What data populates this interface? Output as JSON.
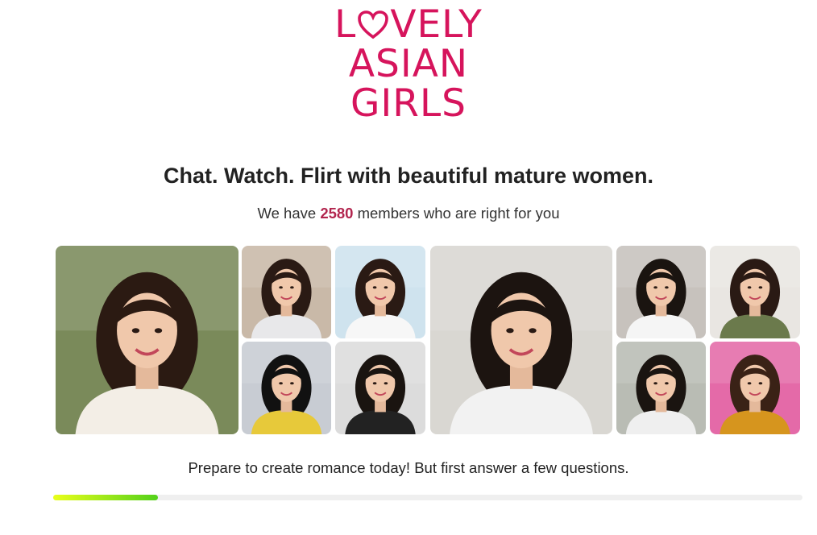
{
  "brand": {
    "logo_line1_before": "L",
    "logo_line1_after": "VELY",
    "logo_line2": "ASIAN",
    "logo_line3": "GIRLS",
    "logo_text": "LOVELY ASIAN GIRLS",
    "color": "#d6145c"
  },
  "hero": {
    "headline": "Chat. Watch. Flirt with beautiful mature women.",
    "sub_before": "We have ",
    "member_count": "2580",
    "sub_after": " members who are right for you"
  },
  "gallery": {
    "photos": [
      {
        "name": "profile-photo-1",
        "bg": "#7a8a5a",
        "hair": "#2b1a12",
        "top": "#f3eee6"
      },
      {
        "name": "profile-photo-2",
        "bg": "#c9b9a8",
        "hair": "#2a1a14",
        "top": "#e8e8ea"
      },
      {
        "name": "profile-photo-3",
        "bg": "#cfe3ee",
        "hair": "#2a1a14",
        "top": "#f7f7f7"
      },
      {
        "name": "profile-photo-4",
        "bg": "#c8ccd3",
        "hair": "#111111",
        "top": "#e7c93a"
      },
      {
        "name": "profile-photo-5",
        "bg": "#dcdcdc",
        "hair": "#1a1410",
        "top": "#222222"
      },
      {
        "name": "profile-photo-6",
        "bg": "#d9d7d2",
        "hair": "#1c1410",
        "top": "#f2f2f2"
      },
      {
        "name": "profile-photo-7",
        "bg": "#c7c2bd",
        "hair": "#1a1410",
        "top": "#f5f5f5"
      },
      {
        "name": "profile-photo-8",
        "bg": "#e9e6e2",
        "hair": "#2a1a14",
        "top": "#6b7a4c"
      },
      {
        "name": "profile-photo-9",
        "bg": "#b9bcb4",
        "hair": "#1a1410",
        "top": "#efefef"
      },
      {
        "name": "profile-photo-10",
        "bg": "#e46aa8",
        "hair": "#3a2216",
        "top": "#d6951e"
      }
    ]
  },
  "cta": {
    "prompt": "Prepare to create romance today! But first answer a few questions."
  },
  "progress": {
    "value_percent": 14,
    "colors": [
      "#e9ff1a",
      "#52d11a"
    ]
  }
}
